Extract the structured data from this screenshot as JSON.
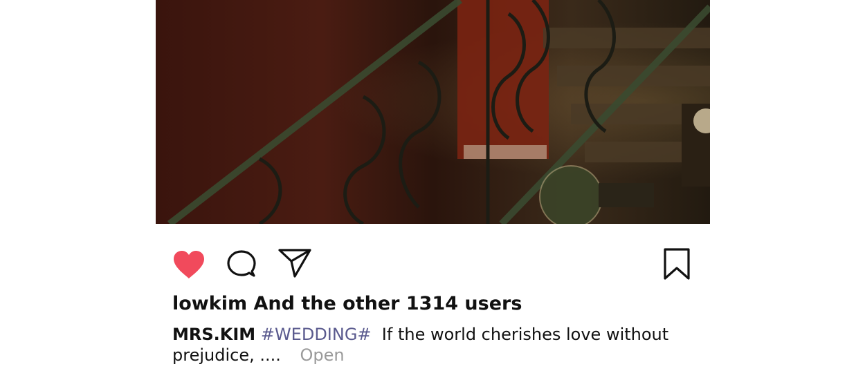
{
  "post": {
    "photo_icon": "staircase-photo",
    "likes_text": "lowkim And the other 1314 users",
    "caption": {
      "author": "MRS.KIM",
      "hashtag": "#WEDDING#",
      "text": "If the world cherishes love without prejudice, ....",
      "more_label": "Open"
    }
  },
  "actions": {
    "like_icon": "heart-icon",
    "comment_icon": "comment-bubble-icon",
    "share_icon": "paper-plane-icon",
    "save_icon": "bookmark-icon",
    "like_color": "#f14a5c"
  }
}
